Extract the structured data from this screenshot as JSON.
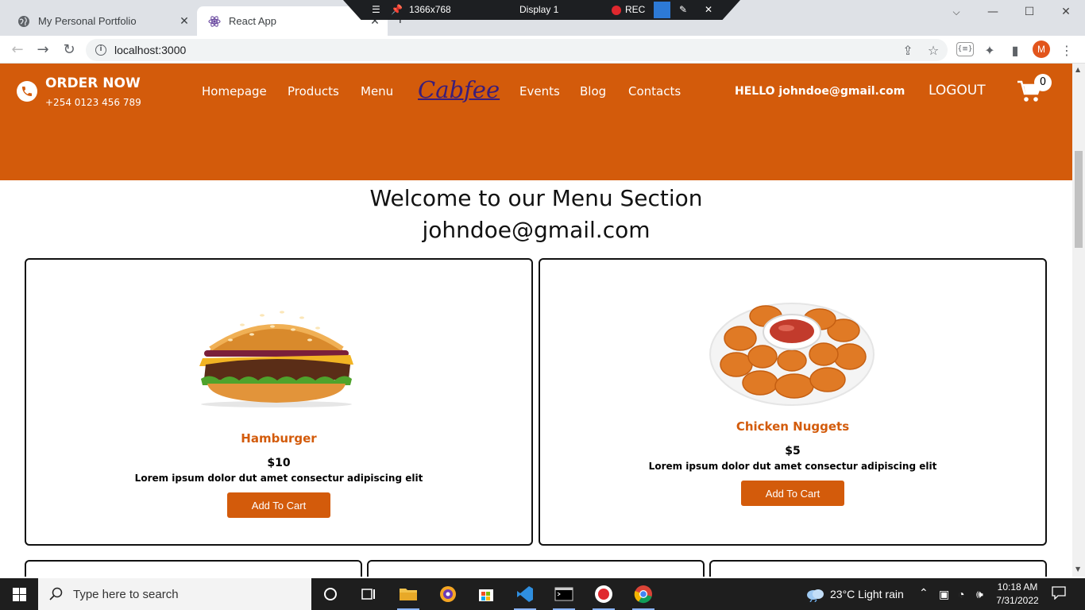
{
  "browser": {
    "tabs": [
      {
        "title": "My Personal Portfolio",
        "active": false
      },
      {
        "title": "React App",
        "active": true
      }
    ],
    "address": "localhost:3000",
    "profile_initial": "M"
  },
  "recorder": {
    "resolution": "1366x768",
    "display": "Display 1",
    "rec_label": "REC"
  },
  "header": {
    "order_title": "ORDER NOW",
    "order_phone": "+254 0123 456 789",
    "nav_left": [
      "Homepage",
      "Products",
      "Menu"
    ],
    "logo": "Cabfee",
    "nav_right": [
      "Events",
      "Blog",
      "Contacts"
    ],
    "hello": "HELLO johndoe@gmail.com",
    "logout": "LOGOUT",
    "cart_count": "0"
  },
  "menu": {
    "welcome": "Welcome to our Menu Section",
    "user_email": "johndoe@gmail.com",
    "items": [
      {
        "name": "Hamburger",
        "price": "$10",
        "desc": "Lorem ipsum dolor dut amet consectur adipiscing elit",
        "button": "Add To Cart"
      },
      {
        "name": "Chicken Nuggets",
        "price": "$5",
        "desc": "Lorem ipsum dolor dut amet consectur adipiscing elit",
        "button": "Add To Cart"
      }
    ]
  },
  "taskbar": {
    "search_placeholder": "Type here to search",
    "weather": "23°C  Light rain",
    "time": "10:18 AM",
    "date": "7/31/2022"
  },
  "colors": {
    "brand": "#d35b0b",
    "logo": "#3b1d7a"
  }
}
